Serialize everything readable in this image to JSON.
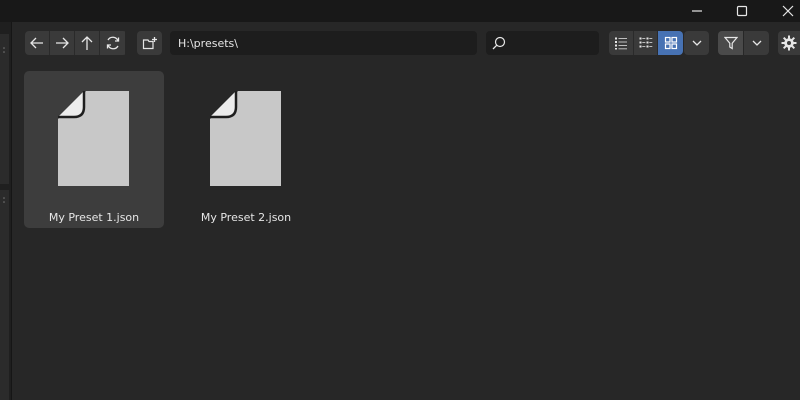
{
  "window": {
    "controls": [
      "minimize-icon",
      "maximize-icon",
      "close-icon"
    ]
  },
  "toolbar": {
    "nav_icons": [
      "back-arrow-icon",
      "forward-arrow-icon",
      "parent-directory-icon",
      "refresh-icon"
    ],
    "new_folder_icon": "new-folder-icon",
    "path": "H:\\presets\\",
    "search": {
      "value": "",
      "placeholder": ""
    },
    "display_modes": [
      {
        "icon": "vertical-list-icon",
        "active": false
      },
      {
        "icon": "horizontal-list-icon",
        "active": false
      },
      {
        "icon": "thumbnails-icon",
        "active": true
      }
    ],
    "filter_icon": "filter-icon",
    "settings_icon": "gear-icon"
  },
  "files": [
    {
      "name": "My Preset 1.json",
      "selected": true
    },
    {
      "name": "My Preset 2.json",
      "selected": false
    }
  ],
  "colors": {
    "background": "#272727",
    "titlebar": "#181818",
    "button": "#3a3a3a",
    "field": "#1d1d1d",
    "accent": "#4772b3",
    "selection": "#3d3d3d",
    "file_icon": "#c8c8c8"
  }
}
